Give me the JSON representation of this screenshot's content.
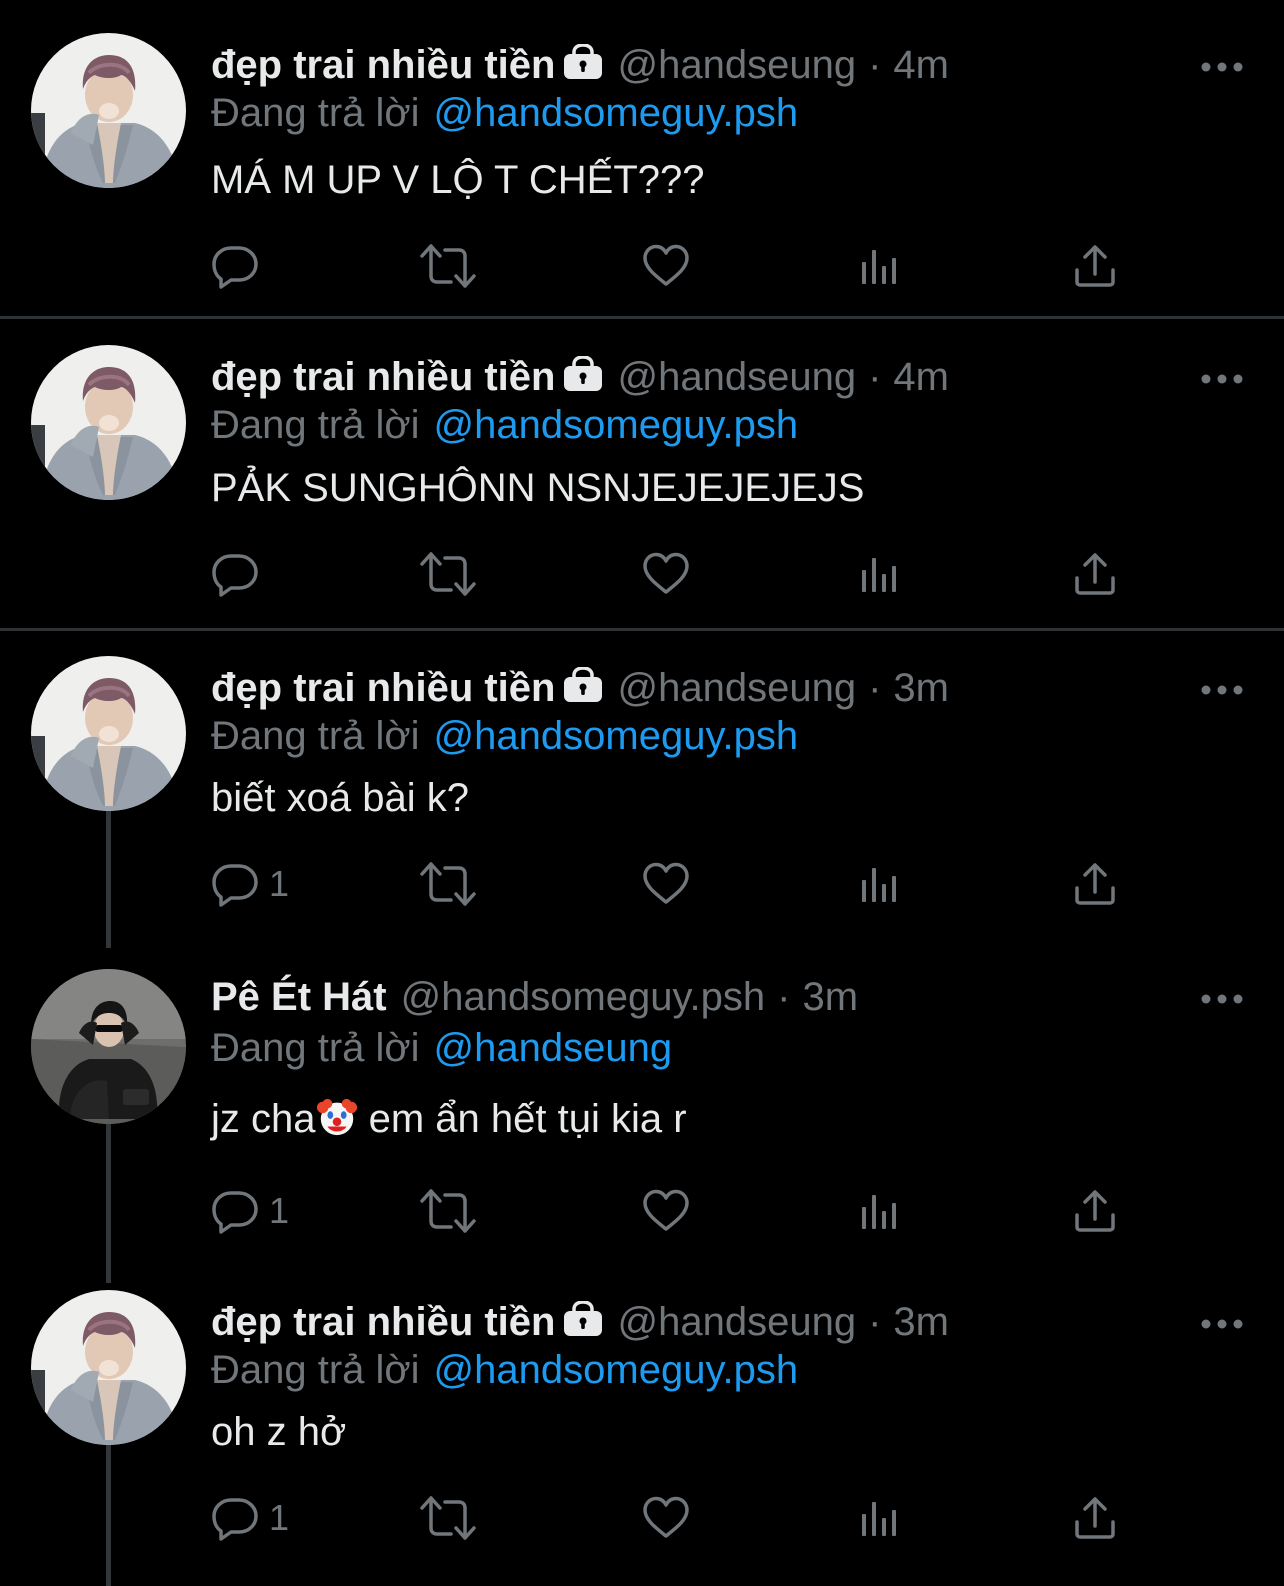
{
  "colors": {
    "background": "#000000",
    "text": "#e7e9ea",
    "muted": "#71767b",
    "link": "#1d9bf0",
    "divider": "#2f3336"
  },
  "tweets": [
    {
      "name": "đẹp trai nhiều tiền",
      "protected": true,
      "handle": "@handseung",
      "sep": "·",
      "time": "4m",
      "reply_prefix": "Đang trả lời",
      "reply_to": "@handsomeguy.psh",
      "text": "MÁ M UP V LỘ T CHẾT???",
      "reply_count": ""
    },
    {
      "name": "đẹp trai nhiều tiền",
      "protected": true,
      "handle": "@handseung",
      "sep": "·",
      "time": "4m",
      "reply_prefix": "Đang trả lời",
      "reply_to": "@handsomeguy.psh",
      "text": "PẢK SUNGHÔNN NSNJEJEJEJEJS",
      "reply_count": ""
    },
    {
      "name": "đẹp trai nhiều tiền",
      "protected": true,
      "handle": "@handseung",
      "sep": "·",
      "time": "3m",
      "reply_prefix": "Đang trả lời",
      "reply_to": "@handsomeguy.psh",
      "text": "biết xoá bài k?",
      "reply_count": "1"
    },
    {
      "name": "Pê Ét Hát",
      "protected": false,
      "handle": "@handsomeguy.psh",
      "sep": "·",
      "time": "3m",
      "reply_prefix": "Đang trả lời",
      "reply_to": "@handseung",
      "text_before_emoji": "jz cha",
      "emoji": "clown-face",
      "text_after_emoji": " em ẩn hết tụi kia r",
      "reply_count": "1"
    },
    {
      "name": "đẹp trai nhiều tiền",
      "protected": true,
      "handle": "@handseung",
      "sep": "·",
      "time": "3m",
      "reply_prefix": "Đang trả lời",
      "reply_to": "@handsomeguy.psh",
      "text": "oh z hở",
      "reply_count": "1"
    }
  ],
  "icons": {
    "more": "more-horizontal-icon",
    "lock": "lock-icon",
    "reply": "reply-icon",
    "retweet": "retweet-icon",
    "like": "heart-icon",
    "views": "analytics-icon",
    "share": "share-icon"
  }
}
